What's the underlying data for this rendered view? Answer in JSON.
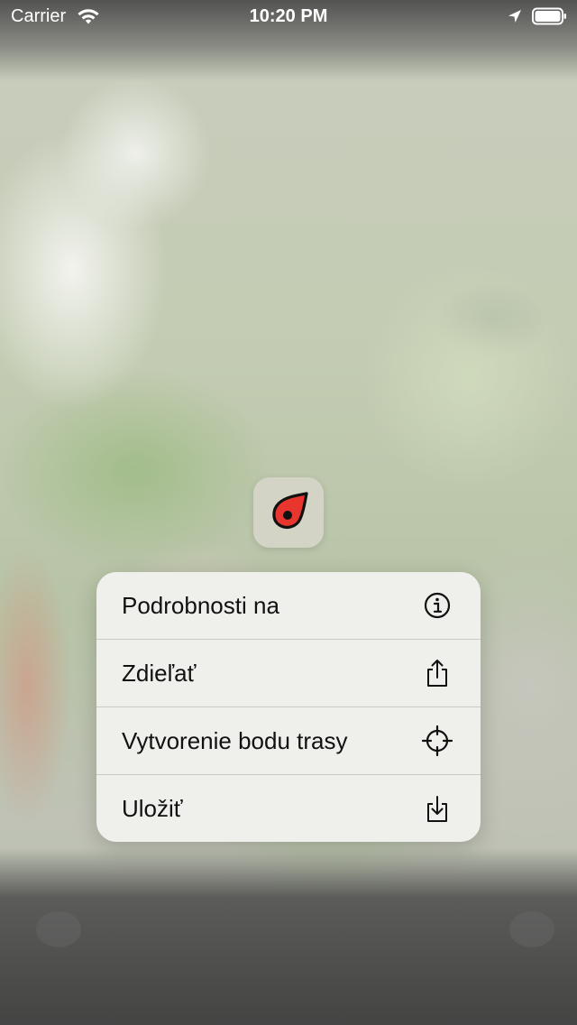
{
  "status_bar": {
    "carrier": "Carrier",
    "time": "10:20 PM",
    "wifi_icon": "wifi-icon",
    "location_icon": "location-arrow-icon",
    "battery_icon": "battery-full-icon"
  },
  "map_pin": {
    "icon": "map-pin-icon",
    "color": "#e8362f"
  },
  "context_menu": {
    "items": [
      {
        "label": "Podrobnosti na",
        "icon": "info-icon"
      },
      {
        "label": "Zdieľať",
        "icon": "share-icon"
      },
      {
        "label": "Vytvorenie bodu trasy",
        "icon": "crosshair-icon"
      },
      {
        "label": "Uložiť",
        "icon": "download-icon"
      }
    ]
  }
}
